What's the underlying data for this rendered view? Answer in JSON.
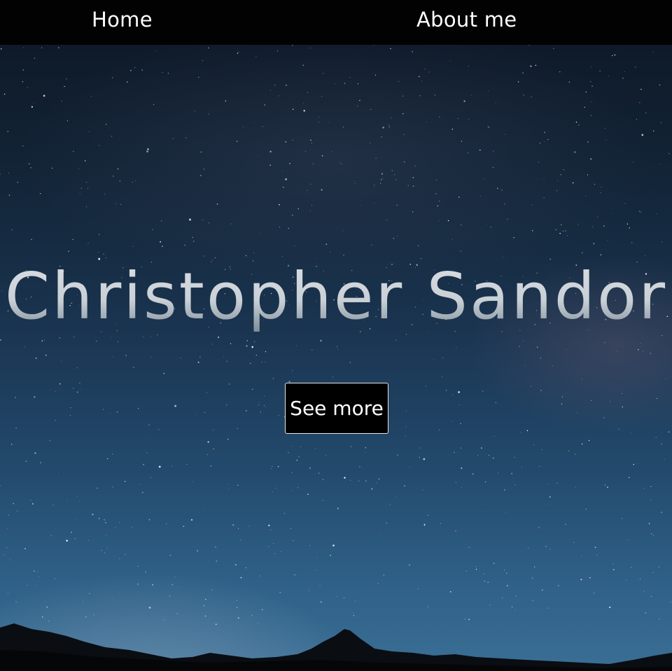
{
  "nav": {
    "home_label": "Home",
    "about_label": "About me"
  },
  "hero": {
    "title": "Christopher Sandor",
    "button_label": "See more"
  },
  "colors": {
    "navbar_bg": "#020202",
    "sky_top": "#0e1a29",
    "sky_bottom": "#3a6f95",
    "title_text": "#c9d0d6",
    "button_bg": "#000000",
    "button_text": "#ffffff"
  }
}
